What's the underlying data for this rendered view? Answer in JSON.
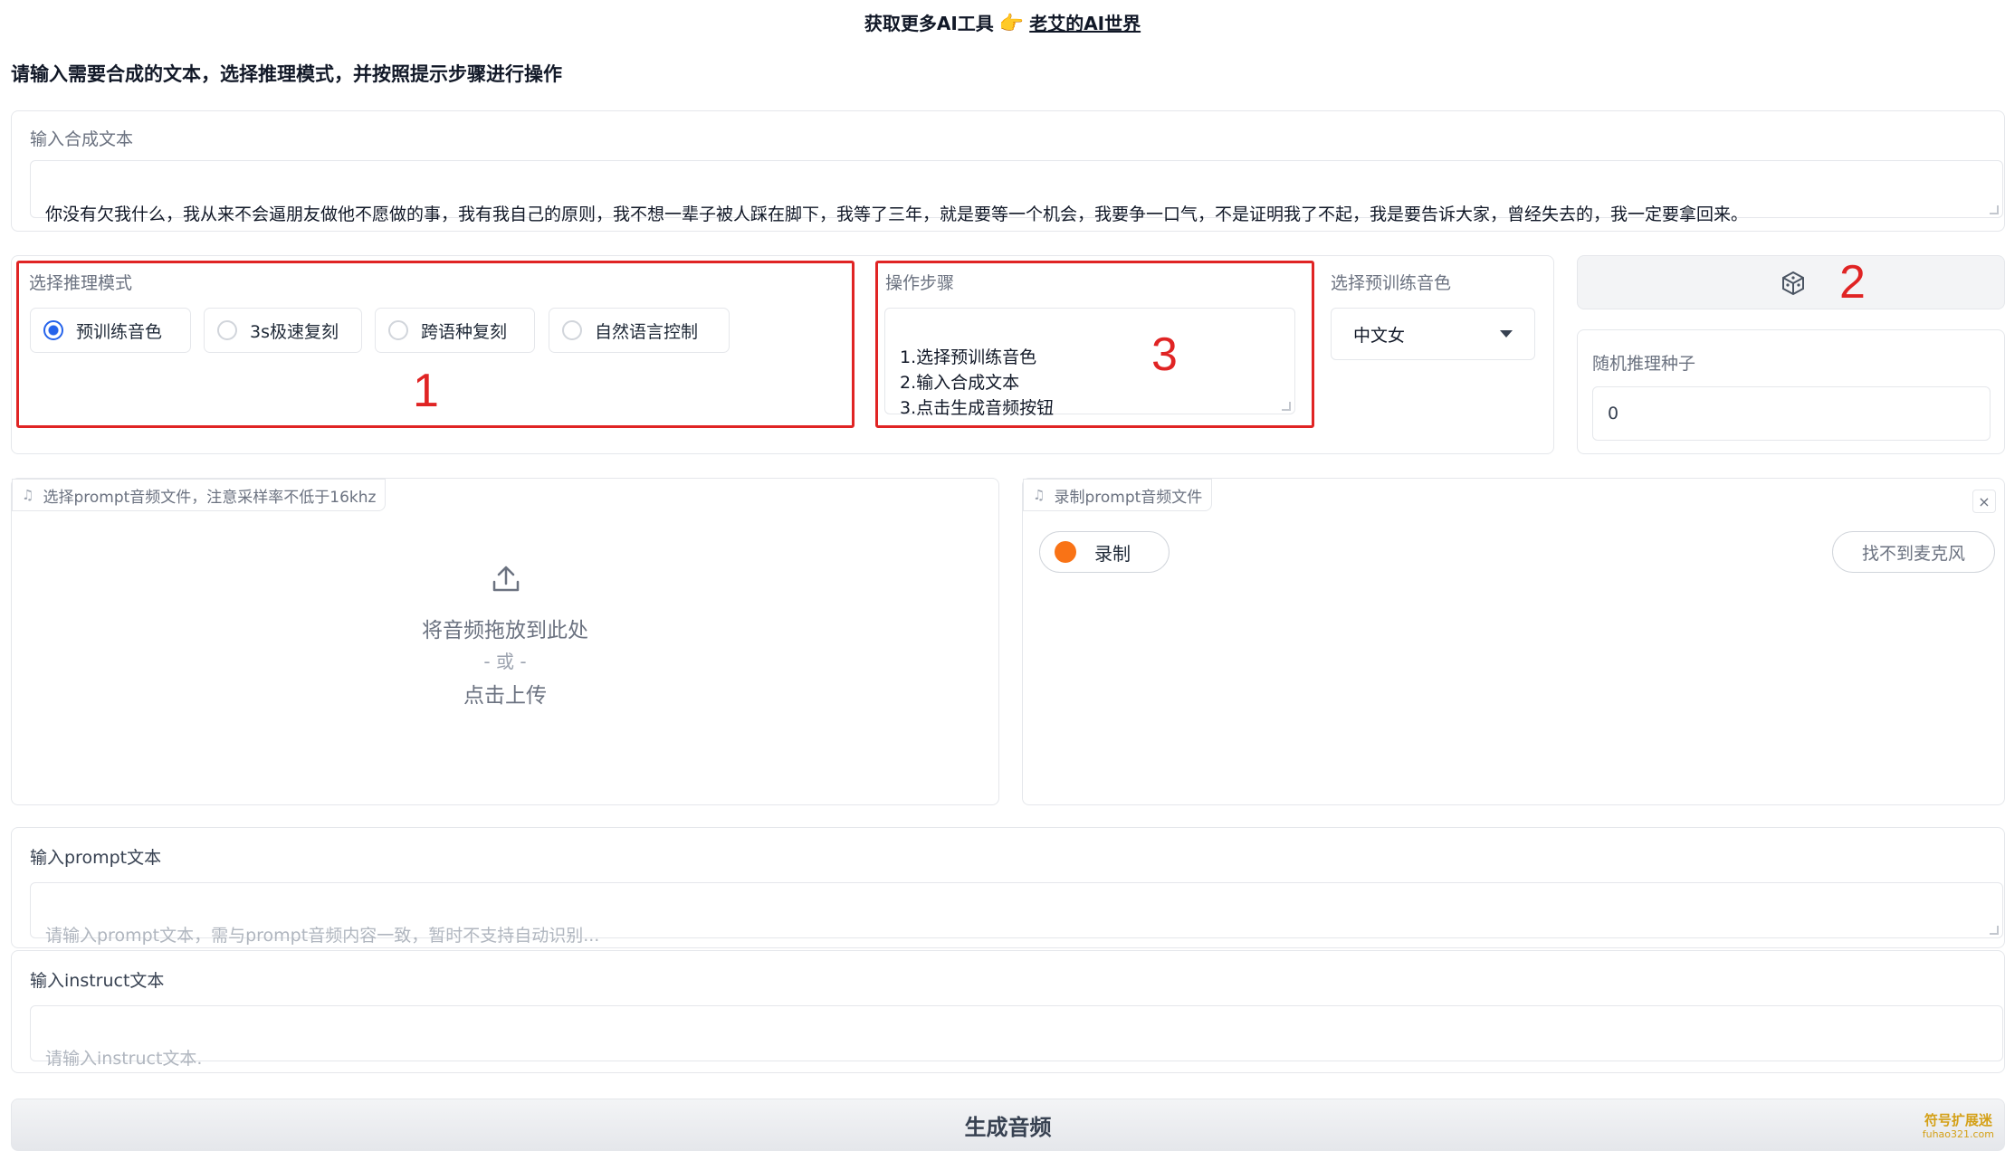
{
  "banner": {
    "prefix": "获取更多AI工具",
    "hand_icon": "pointing-hand-icon",
    "link": "老艾的AI世界"
  },
  "instructions": "请输入需要合成的文本，选择推理模式，并按照提示步骤进行操作",
  "synth_text": {
    "label": "输入合成文本",
    "value": "你没有欠我什么，我从来不会逼朋友做他不愿做的事，我有我自己的原则，我不想一辈子被人踩在脚下，我等了三年，就是要等一个机会，我要争一口气，不是证明我了不起，我是要告诉大家，曾经失去的，我一定要拿回来。"
  },
  "mode": {
    "label": "选择推理模式",
    "options": [
      "预训练音色",
      "3s极速复刻",
      "跨语种复刻",
      "自然语言控制"
    ],
    "selected": "预训练音色"
  },
  "steps": {
    "label": "操作步骤",
    "value": "1.选择预训练音色\n2.输入合成文本\n3.点击生成音频按钮"
  },
  "voice": {
    "label": "选择预训练音色",
    "selected": "中文女"
  },
  "seed": {
    "dice_icon": "dice-icon",
    "label": "随机推理种子",
    "value": "0"
  },
  "annotations": {
    "n1": "1",
    "n2": "2",
    "n3": "3"
  },
  "upload": {
    "tab_label": "选择prompt音频文件，注意采样率不低于16khz",
    "drop_text": "将音频拖放到此处",
    "or_text": "- 或 -",
    "click_text": "点击上传"
  },
  "record": {
    "tab_label": "录制prompt音频文件",
    "record_label": "录制",
    "mic_label": "找不到麦克风",
    "close": "×"
  },
  "prompt_text": {
    "label": "输入prompt文本",
    "placeholder": "请输入prompt文本，需与prompt音频内容一致，暂时不支持自动识别..."
  },
  "instruct_text": {
    "label": "输入instruct文本",
    "placeholder": "请输入instruct文本."
  },
  "generate_button": "生成音频",
  "watermark": {
    "line1": "符号扩展迷",
    "line2": "fuhao321.com"
  },
  "colors": {
    "accent_blue": "#2563eb",
    "annotation_red": "#e02424",
    "record_orange": "#f97316"
  }
}
